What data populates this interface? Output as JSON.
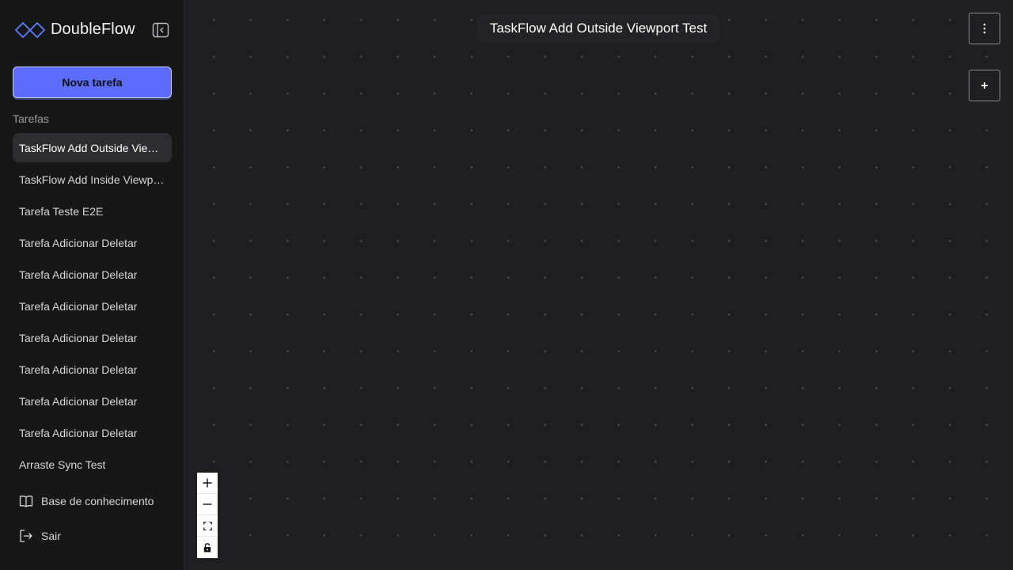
{
  "app": {
    "name": "DoubleFlow"
  },
  "sidebar": {
    "new_task_label": "Nova tarefa",
    "section_label": "Tarefas",
    "tasks": [
      {
        "label": "TaskFlow Add Outside Viewport Test",
        "active": true
      },
      {
        "label": "TaskFlow Add Inside Viewport Test"
      },
      {
        "label": "Tarefa Teste E2E"
      },
      {
        "label": "Tarefa Adicionar Deletar"
      },
      {
        "label": "Tarefa Adicionar Deletar"
      },
      {
        "label": "Tarefa Adicionar Deletar"
      },
      {
        "label": "Tarefa Adicionar Deletar"
      },
      {
        "label": "Tarefa Adicionar Deletar"
      },
      {
        "label": "Tarefa Adicionar Deletar"
      },
      {
        "label": "Tarefa Adicionar Deletar"
      },
      {
        "label": "Arraste Sync Test"
      }
    ],
    "knowledge_base_label": "Base de conhecimento",
    "logout_label": "Sair"
  },
  "canvas": {
    "title": "TaskFlow Add Outside Viewport Test"
  },
  "icons": {
    "logo": "infinity-diamond-icon",
    "collapse": "sidebar-collapse-icon",
    "knowledge_base": "book-icon",
    "logout": "logout-icon",
    "menu": "vertical-dots-icon",
    "add": "plus-icon",
    "zoom_in": "plus-icon",
    "zoom_out": "minus-icon",
    "fit_view": "fit-view-icon",
    "lock": "lock-icon"
  },
  "colors": {
    "accent": "#5b6cff",
    "sidebar_bg": "#171717",
    "canvas_bg": "#1e1e20"
  }
}
